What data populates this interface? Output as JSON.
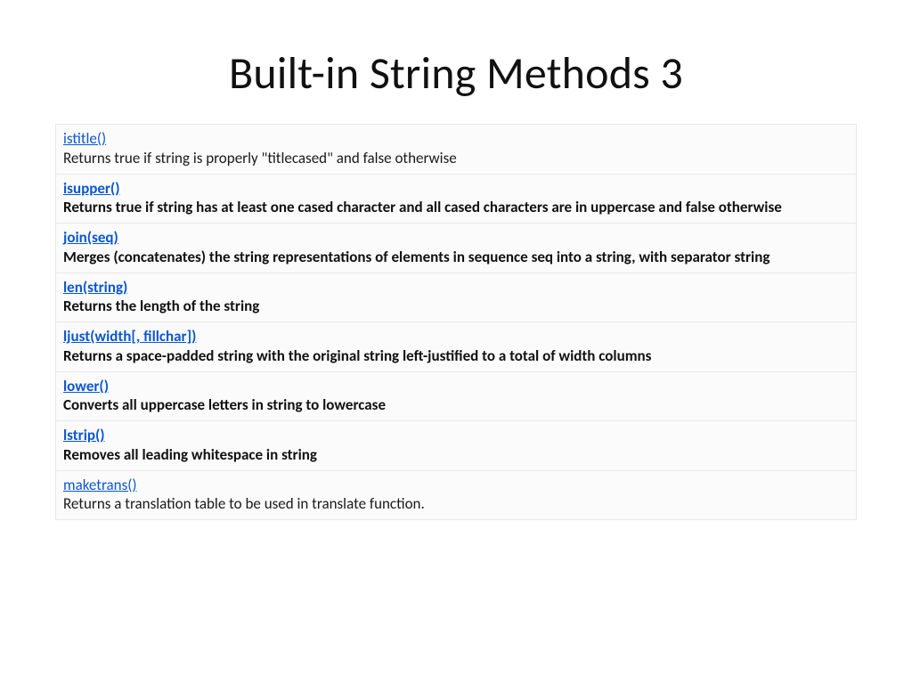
{
  "title": "Built-in String Methods 3",
  "rows": [
    {
      "name": "istitle()",
      "desc": "Returns true if string is properly \"titlecased\" and false otherwise",
      "bold": false
    },
    {
      "name": "isupper()",
      "desc": "Returns true if string has at least one cased character and all cased characters are in uppercase and false otherwise",
      "bold": true
    },
    {
      "name": "join(seq)",
      "desc": "Merges (concatenates) the string representations of elements in sequence seq into a string, with separator string",
      "bold": true
    },
    {
      "name": "len(string)",
      "desc": "Returns the length of the string",
      "bold": true
    },
    {
      "name": "ljust(width[, fillchar])",
      "desc": "Returns a space-padded string with the original string left-justified to a total of width columns",
      "bold": true
    },
    {
      "name": "lower()",
      "desc": "Converts all uppercase letters in string to lowercase",
      "bold": true
    },
    {
      "name": "lstrip()",
      "desc": "Removes all leading whitespace in string",
      "bold": true
    },
    {
      "name": "maketrans()",
      "desc": "Returns a translation table to be used in translate function.",
      "bold": false
    }
  ]
}
